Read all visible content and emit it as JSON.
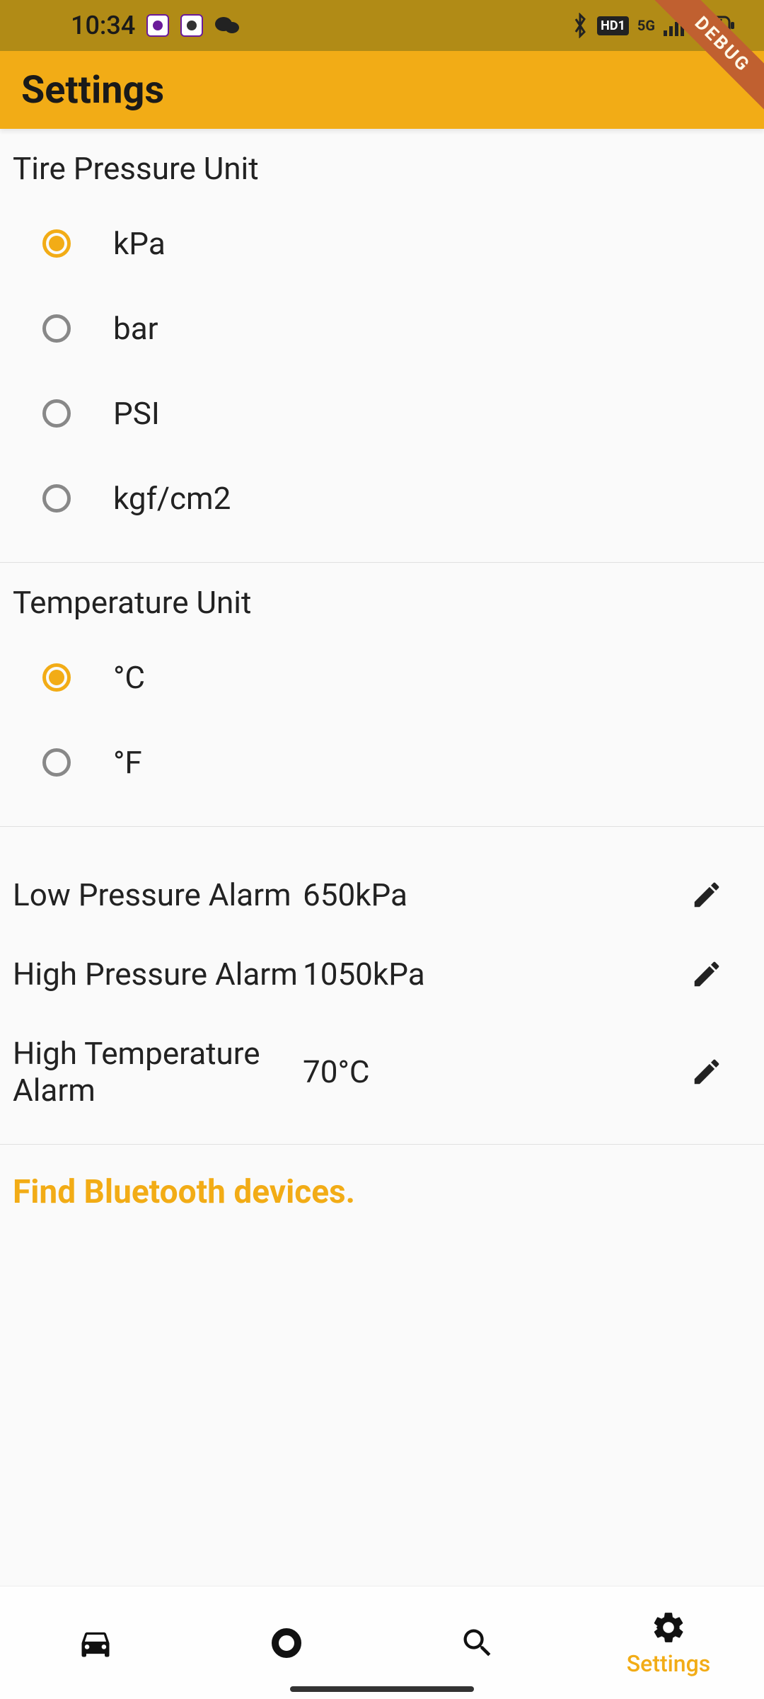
{
  "status_bar": {
    "time": "10:34",
    "network_label": "5G",
    "hd_label": "HD1"
  },
  "debug_ribbon": "DEBUG",
  "app_bar": {
    "title": "Settings"
  },
  "pressure_unit": {
    "title": "Tire Pressure Unit",
    "options": [
      {
        "label": "kPa",
        "selected": true
      },
      {
        "label": "bar",
        "selected": false
      },
      {
        "label": "PSI",
        "selected": false
      },
      {
        "label": "kgf/cm2",
        "selected": false
      }
    ]
  },
  "temperature_unit": {
    "title": "Temperature Unit",
    "options": [
      {
        "label": "°C",
        "selected": true
      },
      {
        "label": "°F",
        "selected": false
      }
    ]
  },
  "alarms": {
    "low_pressure": {
      "label": "Low Pressure Alarm",
      "value": "650kPa"
    },
    "high_pressure": {
      "label": "High Pressure Alarm",
      "value": "1050kPa"
    },
    "high_temperature": {
      "label": "High Temperature Alarm",
      "value": "70°C"
    }
  },
  "bluetooth": {
    "title": "Find Bluetooth devices."
  },
  "nav": {
    "settings_label": "Settings"
  }
}
